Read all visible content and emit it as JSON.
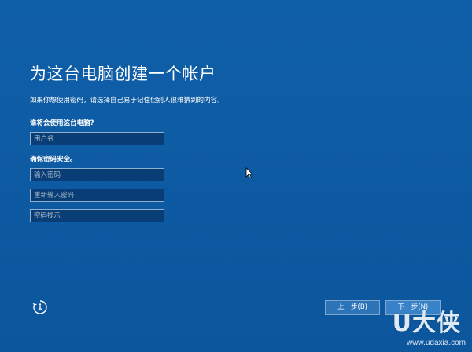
{
  "page": {
    "title": "为这台电脑创建一个帐户",
    "subtitle": "如果你想使用密码，请选择自己易于记住但别人很难猜到的内容。"
  },
  "form": {
    "user_label": "谁将会使用这台电脑?",
    "username_placeholder": "用户名",
    "password_label": "确保密码安全。",
    "password_placeholder": "输入密码",
    "confirm_placeholder": "重新输入密码",
    "hint_placeholder": "密码提示"
  },
  "footer": {
    "accessibility_icon": "ease-of-access-icon",
    "back_label": "上一步(B)",
    "next_label": "下一步(N)"
  },
  "watermark": {
    "logo": "U大侠",
    "url": "www.udaxia.com"
  },
  "colors": {
    "background": "#0e5ba3",
    "field_background": "#083d75",
    "button_background": "#2d73b8"
  }
}
